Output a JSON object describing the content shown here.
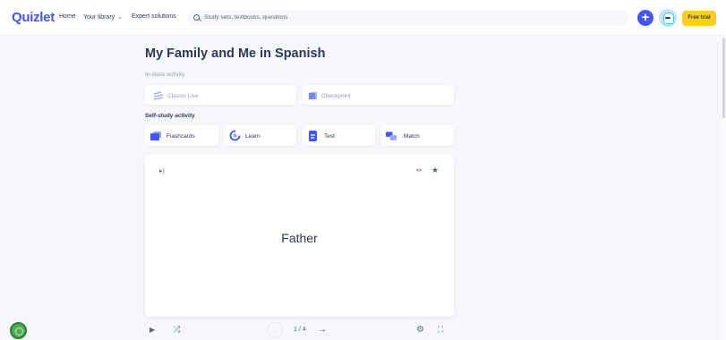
{
  "header": {
    "logo": "Quizlet",
    "nav": {
      "home": "Home",
      "library": "Your library",
      "expert": "Expert solutions"
    },
    "search_placeholder": "Study sets, textbooks, questions",
    "trial_label": "Free trial"
  },
  "page": {
    "title": "My Family and Me in Spanish",
    "in_class_label": "In-class activity",
    "self_study_label": "Self-study activity"
  },
  "activities": {
    "in_class": [
      {
        "label": "Classic Live",
        "icon": "classic-live-icon"
      },
      {
        "label": "Checkpoint",
        "icon": "checkpoint-icon"
      }
    ],
    "self_study": [
      {
        "label": "Flashcards",
        "icon": "flashcards-icon"
      },
      {
        "label": "Learn",
        "icon": "learn-icon"
      },
      {
        "label": "Test",
        "icon": "test-icon"
      },
      {
        "label": "Match",
        "icon": "match-icon"
      }
    ]
  },
  "flashcard": {
    "term": "Father"
  },
  "controls": {
    "counter": "1 / 4"
  },
  "colors": {
    "brand": "#4255ff",
    "trial": "#ffcd1f",
    "background": "#f6f7fb",
    "text": "#2e3856"
  }
}
